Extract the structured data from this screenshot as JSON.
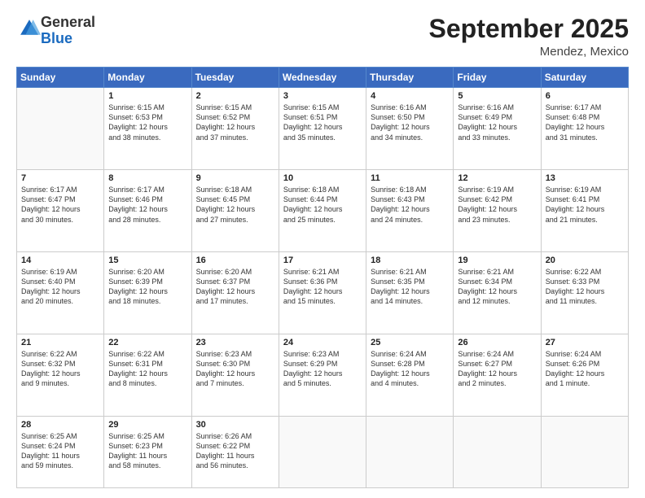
{
  "header": {
    "logo_general": "General",
    "logo_blue": "Blue",
    "month_title": "September 2025",
    "location": "Mendez, Mexico"
  },
  "days_of_week": [
    "Sunday",
    "Monday",
    "Tuesday",
    "Wednesday",
    "Thursday",
    "Friday",
    "Saturday"
  ],
  "weeks": [
    [
      {
        "num": "",
        "info": ""
      },
      {
        "num": "1",
        "info": "Sunrise: 6:15 AM\nSunset: 6:53 PM\nDaylight: 12 hours\nand 38 minutes."
      },
      {
        "num": "2",
        "info": "Sunrise: 6:15 AM\nSunset: 6:52 PM\nDaylight: 12 hours\nand 37 minutes."
      },
      {
        "num": "3",
        "info": "Sunrise: 6:15 AM\nSunset: 6:51 PM\nDaylight: 12 hours\nand 35 minutes."
      },
      {
        "num": "4",
        "info": "Sunrise: 6:16 AM\nSunset: 6:50 PM\nDaylight: 12 hours\nand 34 minutes."
      },
      {
        "num": "5",
        "info": "Sunrise: 6:16 AM\nSunset: 6:49 PM\nDaylight: 12 hours\nand 33 minutes."
      },
      {
        "num": "6",
        "info": "Sunrise: 6:17 AM\nSunset: 6:48 PM\nDaylight: 12 hours\nand 31 minutes."
      }
    ],
    [
      {
        "num": "7",
        "info": "Sunrise: 6:17 AM\nSunset: 6:47 PM\nDaylight: 12 hours\nand 30 minutes."
      },
      {
        "num": "8",
        "info": "Sunrise: 6:17 AM\nSunset: 6:46 PM\nDaylight: 12 hours\nand 28 minutes."
      },
      {
        "num": "9",
        "info": "Sunrise: 6:18 AM\nSunset: 6:45 PM\nDaylight: 12 hours\nand 27 minutes."
      },
      {
        "num": "10",
        "info": "Sunrise: 6:18 AM\nSunset: 6:44 PM\nDaylight: 12 hours\nand 25 minutes."
      },
      {
        "num": "11",
        "info": "Sunrise: 6:18 AM\nSunset: 6:43 PM\nDaylight: 12 hours\nand 24 minutes."
      },
      {
        "num": "12",
        "info": "Sunrise: 6:19 AM\nSunset: 6:42 PM\nDaylight: 12 hours\nand 23 minutes."
      },
      {
        "num": "13",
        "info": "Sunrise: 6:19 AM\nSunset: 6:41 PM\nDaylight: 12 hours\nand 21 minutes."
      }
    ],
    [
      {
        "num": "14",
        "info": "Sunrise: 6:19 AM\nSunset: 6:40 PM\nDaylight: 12 hours\nand 20 minutes."
      },
      {
        "num": "15",
        "info": "Sunrise: 6:20 AM\nSunset: 6:39 PM\nDaylight: 12 hours\nand 18 minutes."
      },
      {
        "num": "16",
        "info": "Sunrise: 6:20 AM\nSunset: 6:37 PM\nDaylight: 12 hours\nand 17 minutes."
      },
      {
        "num": "17",
        "info": "Sunrise: 6:21 AM\nSunset: 6:36 PM\nDaylight: 12 hours\nand 15 minutes."
      },
      {
        "num": "18",
        "info": "Sunrise: 6:21 AM\nSunset: 6:35 PM\nDaylight: 12 hours\nand 14 minutes."
      },
      {
        "num": "19",
        "info": "Sunrise: 6:21 AM\nSunset: 6:34 PM\nDaylight: 12 hours\nand 12 minutes."
      },
      {
        "num": "20",
        "info": "Sunrise: 6:22 AM\nSunset: 6:33 PM\nDaylight: 12 hours\nand 11 minutes."
      }
    ],
    [
      {
        "num": "21",
        "info": "Sunrise: 6:22 AM\nSunset: 6:32 PM\nDaylight: 12 hours\nand 9 minutes."
      },
      {
        "num": "22",
        "info": "Sunrise: 6:22 AM\nSunset: 6:31 PM\nDaylight: 12 hours\nand 8 minutes."
      },
      {
        "num": "23",
        "info": "Sunrise: 6:23 AM\nSunset: 6:30 PM\nDaylight: 12 hours\nand 7 minutes."
      },
      {
        "num": "24",
        "info": "Sunrise: 6:23 AM\nSunset: 6:29 PM\nDaylight: 12 hours\nand 5 minutes."
      },
      {
        "num": "25",
        "info": "Sunrise: 6:24 AM\nSunset: 6:28 PM\nDaylight: 12 hours\nand 4 minutes."
      },
      {
        "num": "26",
        "info": "Sunrise: 6:24 AM\nSunset: 6:27 PM\nDaylight: 12 hours\nand 2 minutes."
      },
      {
        "num": "27",
        "info": "Sunrise: 6:24 AM\nSunset: 6:26 PM\nDaylight: 12 hours\nand 1 minute."
      }
    ],
    [
      {
        "num": "28",
        "info": "Sunrise: 6:25 AM\nSunset: 6:24 PM\nDaylight: 11 hours\nand 59 minutes."
      },
      {
        "num": "29",
        "info": "Sunrise: 6:25 AM\nSunset: 6:23 PM\nDaylight: 11 hours\nand 58 minutes."
      },
      {
        "num": "30",
        "info": "Sunrise: 6:26 AM\nSunset: 6:22 PM\nDaylight: 11 hours\nand 56 minutes."
      },
      {
        "num": "",
        "info": ""
      },
      {
        "num": "",
        "info": ""
      },
      {
        "num": "",
        "info": ""
      },
      {
        "num": "",
        "info": ""
      }
    ]
  ]
}
